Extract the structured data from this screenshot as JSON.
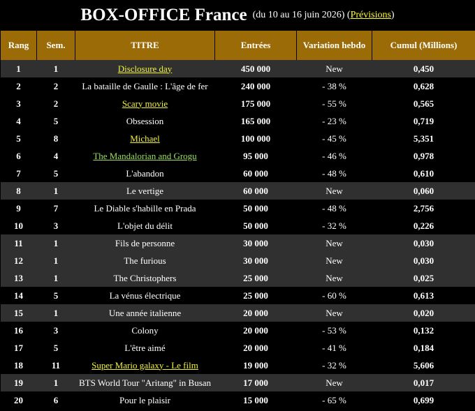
{
  "header": {
    "title": "BOX-OFFICE France",
    "period_prefix": "(du 10 au 16 juin 2026) (",
    "previsions_link": "Prévisions",
    "period_suffix": ")"
  },
  "columns": {
    "rank": "Rang",
    "weeks": "Sem.",
    "title": "TITRE",
    "entries": "Entrées",
    "variation": "Variation hebdo",
    "cumul": "Cumul (Millions)"
  },
  "colors": {
    "header_bg": "#9b6b08",
    "new_row_bg": "#303030",
    "link_yellow": "#ffff33",
    "link_green": "#9be05a"
  },
  "rows": [
    {
      "rank": "1",
      "weeks": "1",
      "title": "Disclosure day",
      "entries": "450 000",
      "variation": "New",
      "cumul": "0,450",
      "link": "yellow",
      "is_new": true
    },
    {
      "rank": "2",
      "weeks": "2",
      "title": "La bataille de Gaulle : L'âge de fer",
      "entries": "240 000",
      "variation": "- 38 %",
      "cumul": "0,628",
      "link": "",
      "is_new": false
    },
    {
      "rank": "3",
      "weeks": "2",
      "title": "Scary movie",
      "entries": "175 000",
      "variation": "- 55 %",
      "cumul": "0,565",
      "link": "yellow",
      "is_new": false
    },
    {
      "rank": "4",
      "weeks": "5",
      "title": "Obsession",
      "entries": "165 000",
      "variation": "- 23 %",
      "cumul": "0,719",
      "link": "",
      "is_new": false
    },
    {
      "rank": "5",
      "weeks": "8",
      "title": "Michael",
      "entries": "100 000",
      "variation": "- 45 %",
      "cumul": "5,351",
      "link": "yellow",
      "is_new": false
    },
    {
      "rank": "6",
      "weeks": "4",
      "title": "The Mandalorian and Grogu",
      "entries": "95 000",
      "variation": "- 46 %",
      "cumul": "0,978",
      "link": "green",
      "is_new": false
    },
    {
      "rank": "7",
      "weeks": "5",
      "title": "L'abandon",
      "entries": "60 000",
      "variation": "- 48 %",
      "cumul": "0,610",
      "link": "",
      "is_new": false
    },
    {
      "rank": "8",
      "weeks": "1",
      "title": "Le vertige",
      "entries": "60 000",
      "variation": "New",
      "cumul": "0,060",
      "link": "",
      "is_new": true
    },
    {
      "rank": "9",
      "weeks": "7",
      "title": "Le Diable s'habille en Prada",
      "entries": "50 000",
      "variation": "- 48 %",
      "cumul": "2,756",
      "link": "",
      "is_new": false
    },
    {
      "rank": "10",
      "weeks": "3",
      "title": "L'objet du délit",
      "entries": "50 000",
      "variation": "- 32 %",
      "cumul": "0,226",
      "link": "",
      "is_new": false
    },
    {
      "rank": "11",
      "weeks": "1",
      "title": "Fils de personne",
      "entries": "30 000",
      "variation": "New",
      "cumul": "0,030",
      "link": "",
      "is_new": true
    },
    {
      "rank": "12",
      "weeks": "1",
      "title": "The furious",
      "entries": "30 000",
      "variation": "New",
      "cumul": "0,030",
      "link": "",
      "is_new": true
    },
    {
      "rank": "13",
      "weeks": "1",
      "title": "The Christophers",
      "entries": "25 000",
      "variation": "New",
      "cumul": "0,025",
      "link": "",
      "is_new": true
    },
    {
      "rank": "14",
      "weeks": "5",
      "title": "La vénus électrique",
      "entries": "25 000",
      "variation": "- 60 %",
      "cumul": "0,613",
      "link": "",
      "is_new": false
    },
    {
      "rank": "15",
      "weeks": "1",
      "title": "Une année italienne",
      "entries": "20 000",
      "variation": "New",
      "cumul": "0,020",
      "link": "",
      "is_new": true
    },
    {
      "rank": "16",
      "weeks": "3",
      "title": "Colony",
      "entries": "20 000",
      "variation": "- 53 %",
      "cumul": "0,132",
      "link": "",
      "is_new": false
    },
    {
      "rank": "17",
      "weeks": "5",
      "title": "L'être aimé",
      "entries": "20 000",
      "variation": "- 41 %",
      "cumul": "0,184",
      "link": "",
      "is_new": false
    },
    {
      "rank": "18",
      "weeks": "11",
      "title": "Super Mario galaxy - Le film",
      "entries": "19 000",
      "variation": "- 32 %",
      "cumul": "5,606",
      "link": "yellow",
      "is_new": false
    },
    {
      "rank": "19",
      "weeks": "1",
      "title": "BTS World Tour \"Aritang\" in Busan",
      "entries": "17 000",
      "variation": "New",
      "cumul": "0,017",
      "link": "",
      "is_new": true
    },
    {
      "rank": "20",
      "weeks": "6",
      "title": "Pour le plaisir",
      "entries": "15 000",
      "variation": "- 65 %",
      "cumul": "0,699",
      "link": "",
      "is_new": false
    }
  ]
}
